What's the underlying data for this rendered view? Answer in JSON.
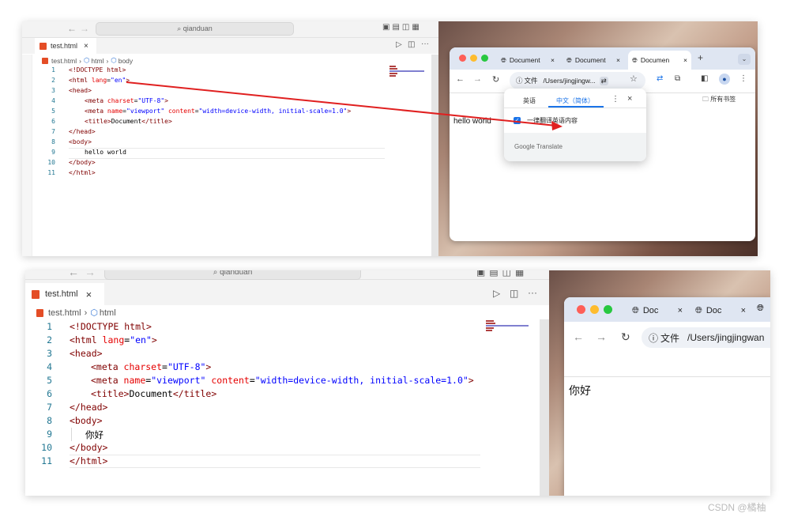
{
  "top": {
    "editor": {
      "search_text": "qianduan",
      "tab_label": "test.html",
      "tab_close": "×",
      "breadcrumb": [
        "test.html",
        "html",
        "body"
      ],
      "line_numbers": [
        "1",
        "2",
        "3",
        "4",
        "5",
        "6",
        "7",
        "8",
        "9",
        "10",
        "11"
      ],
      "code": {
        "l1_a": "<!DOCTYPE ",
        "l1_b": "html",
        "l1_c": ">",
        "l2_tag": "<html ",
        "l2_attr": "lang",
        "l2_eq": "=",
        "l2_val": "\"en\"",
        "l2_end": ">",
        "l3": "<head>",
        "l4_tag": "<meta ",
        "l4_attr": "charset",
        "l4_eq": "=",
        "l4_val": "\"UTF-8\"",
        "l4_end": ">",
        "l5_tag": "<meta ",
        "l5_attr1": "name",
        "l5_eq1": "=",
        "l5_val1": "\"viewport\"",
        "l5_attr2": " content",
        "l5_eq2": "=",
        "l5_val2": "\"width=device-width, initial-scale=1.0\"",
        "l5_end": ">",
        "l6_open": "<title>",
        "l6_text": "Document",
        "l6_close": "</title>",
        "l7": "</head>",
        "l8": "<body>",
        "l9": "hello world",
        "l10": "</body>",
        "l11": "</html>"
      }
    },
    "browser": {
      "tabs": [
        "Document",
        "Document",
        "Documen"
      ],
      "tab_close": "×",
      "new_tab": "+",
      "addr_prefix": "文件",
      "addr_text": "/Users/jingjingw...",
      "bookmarks": "所有书签",
      "page_text": "hello world",
      "translate": {
        "tab_source": "英语",
        "tab_target": "中文（简体）",
        "always_label": "一律翻译英语内容",
        "footer": "Google Translate"
      }
    }
  },
  "bottom": {
    "editor": {
      "search_text": "qianduan",
      "tab_label": "test.html",
      "tab_close": "×",
      "breadcrumb": [
        "test.html",
        "html"
      ],
      "line_numbers": [
        "1",
        "2",
        "3",
        "4",
        "5",
        "6",
        "7",
        "8",
        "9",
        "10",
        "11"
      ],
      "l9": "你好"
    },
    "browser": {
      "tabs": [
        "Doc",
        "Doc"
      ],
      "tab_close": "×",
      "addr_prefix": "文件",
      "addr_text": "/Users/jingjingwan",
      "page_text": "你好"
    }
  },
  "watermark": "CSDN @橘柚",
  "colors": {
    "tag": "#800000",
    "attr": "#e50000",
    "string": "#0000ff",
    "line_number": "#237893",
    "arrow": "#e02020",
    "accent": "#1a73e8"
  }
}
